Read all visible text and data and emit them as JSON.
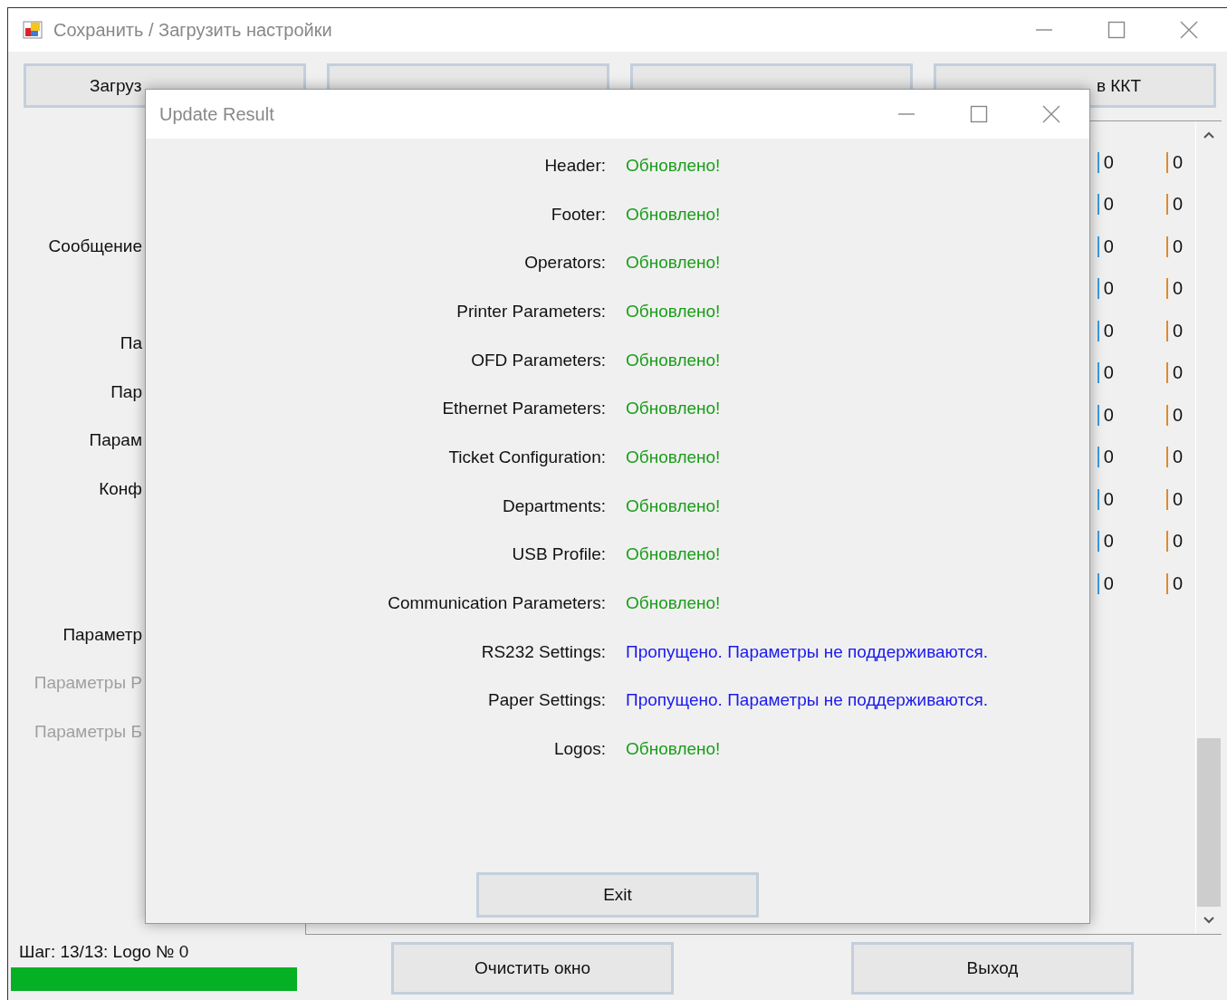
{
  "window": {
    "title": "Сохранить / Загрузить настройки"
  },
  "top_buttons": [
    {
      "label": "Загруз"
    },
    {
      "label": "в ККТ"
    }
  ],
  "side_labels": [
    {
      "label": "Сообщение",
      "disabled": false
    },
    {
      "label": "Па",
      "disabled": false
    },
    {
      "label": "Пар",
      "disabled": false
    },
    {
      "label": "Парам",
      "disabled": false
    },
    {
      "label": "Конф",
      "disabled": false
    },
    {
      "label": "Параметр",
      "disabled": false
    },
    {
      "label": "Параметры Р",
      "disabled": true
    },
    {
      "label": "Параметры Б",
      "disabled": true
    }
  ],
  "values": [
    {
      "column_1": "0",
      "column_2": "0"
    },
    {
      "column_1": "0",
      "column_2": "0"
    },
    {
      "column_1": "0",
      "column_2": "0"
    },
    {
      "column_1": "0",
      "column_2": "0"
    },
    {
      "column_1": "0",
      "column_2": "0"
    },
    {
      "column_1": "0",
      "column_2": "0"
    },
    {
      "column_1": "0",
      "column_2": "0"
    },
    {
      "column_1": "0",
      "column_2": "0"
    },
    {
      "column_1": "0",
      "column_2": "0"
    },
    {
      "column_1": "0",
      "column_2": "0"
    },
    {
      "column_1": "0",
      "column_2": "0"
    }
  ],
  "status": {
    "text": "Шаг: 13/13: Logo № 0",
    "level": 1
  },
  "bottom_buttons": [
    "Очистить окно",
    "Выход"
  ],
  "dialog": {
    "title": "Update Result",
    "results": [
      {
        "label": "Header:",
        "status": "Обновлено!",
        "kind": "ok"
      },
      {
        "label": "Footer:",
        "status": "Обновлено!",
        "kind": "ok"
      },
      {
        "label": "Operators:",
        "status": "Обновлено!",
        "kind": "ok"
      },
      {
        "label": "Printer Parameters:",
        "status": "Обновлено!",
        "kind": "ok"
      },
      {
        "label": "OFD Parameters:",
        "status": "Обновлено!",
        "kind": "ok"
      },
      {
        "label": "Ethernet Parameters:",
        "status": "Обновлено!",
        "kind": "ok"
      },
      {
        "label": "Ticket Configuration:",
        "status": "Обновлено!",
        "kind": "ok"
      },
      {
        "label": "Departments:",
        "status": "Обновлено!",
        "kind": "ok"
      },
      {
        "label": "USB Profile:",
        "status": "Обновлено!",
        "kind": "ok"
      },
      {
        "label": "Communication Parameters:",
        "status": "Обновлено!",
        "kind": "ok"
      },
      {
        "label": "RS232 Settings:",
        "status": "Пропущено. Параметры не поддерживаются.",
        "kind": "skipped"
      },
      {
        "label": "Paper Settings:",
        "status": "Пропущено. Параметры не поддерживаются.",
        "kind": "skipped"
      },
      {
        "label": "Logos:",
        "status": "Обновлено!",
        "kind": "ok"
      }
    ],
    "button": "Exit"
  }
}
